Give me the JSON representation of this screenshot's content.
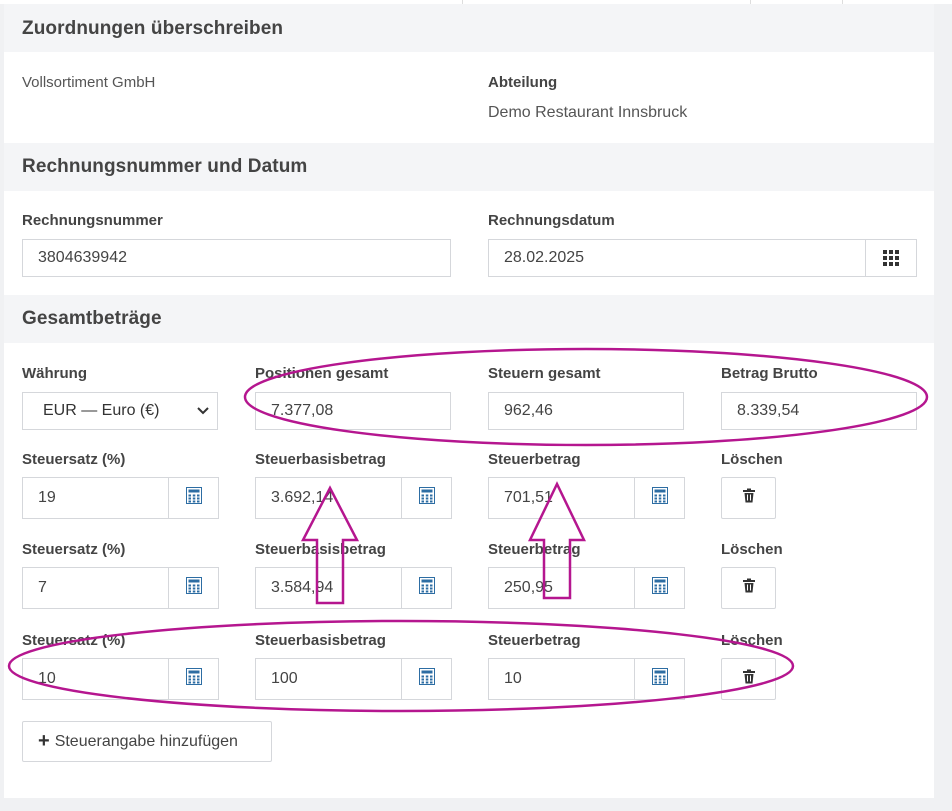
{
  "sections": {
    "assignments": {
      "title": "Zuordnungen überschreiben",
      "company": "Vollsortiment GmbH",
      "department_label": "Abteilung",
      "department_value": "Demo Restaurant Innsbruck"
    },
    "invoice": {
      "title": "Rechnungsnummer und Datum",
      "number_label": "Rechnungsnummer",
      "number_value": "3804639942",
      "date_label": "Rechnungsdatum",
      "date_value": "28.02.2025"
    },
    "totals": {
      "title": "Gesamtbeträge",
      "currency_label": "Währung",
      "currency_value": "EUR — Euro (€)",
      "positions_label": "Positionen gesamt",
      "positions_value": "7.377,08",
      "taxes_label": "Steuern gesamt",
      "taxes_value": "962,46",
      "gross_label": "Betrag Brutto",
      "gross_value": "8.339,54"
    }
  },
  "tax_rows": [
    {
      "rate_label": "Steuersatz (%)",
      "rate": "19",
      "base_label": "Steuerbasisbetrag",
      "base": "3.692,14",
      "tax_label": "Steuerbetrag",
      "tax": "701,51",
      "delete_label": "Löschen"
    },
    {
      "rate_label": "Steuersatz (%)",
      "rate": "7",
      "base_label": "Steuerbasisbetrag",
      "base": "3.584,94",
      "tax_label": "Steuerbetrag",
      "tax": "250,95",
      "delete_label": "Löschen"
    },
    {
      "rate_label": "Steuersatz (%)",
      "rate": "10",
      "base_label": "Steuerbasisbetrag",
      "base": "100",
      "tax_label": "Steuerbetrag",
      "tax": "10",
      "delete_label": "Löschen"
    }
  ],
  "add_tax_label": "Steuerangabe hinzufügen",
  "icons": {
    "calculator": "calculator-icon",
    "calendar": "calendar-grid-icon",
    "trash": "trash-icon",
    "plus": "plus-icon"
  },
  "colors": {
    "annotation": "#b5168f",
    "calculator_blue": "#2d6da3"
  }
}
